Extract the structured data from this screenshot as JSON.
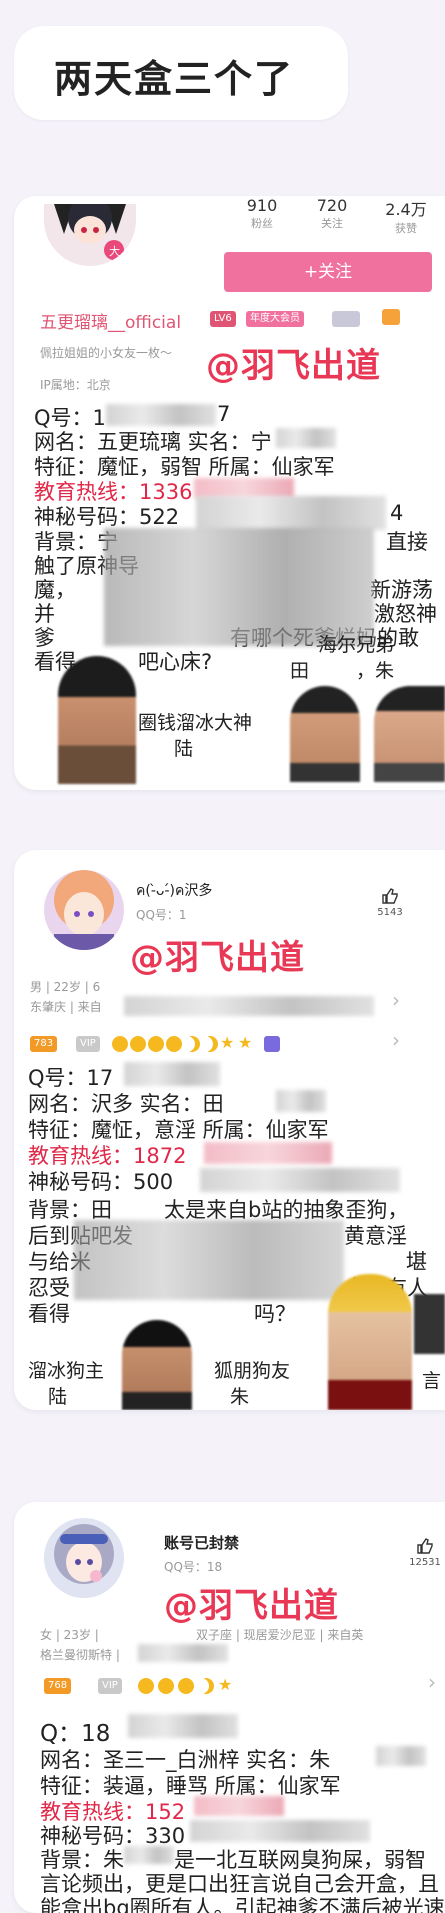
{
  "title": "两天盒三个了",
  "card1": {
    "stats": [
      {
        "num": "910",
        "label": "粉丝"
      },
      {
        "num": "720",
        "label": "关注"
      },
      {
        "num": "2.4万",
        "label": "获赞"
      }
    ],
    "follow_label": "+关注",
    "username": "五更瑠璃__official",
    "level": "LV6",
    "year_badge": "年度大会员",
    "sign": "佩拉姐姐的小女友一枚～",
    "ip": "IP属地：北京",
    "watermark": "@羽飞出道",
    "lines": {
      "qq": "Q号：1",
      "qq_end": "7",
      "netname": "网名：五更琉璃  实名：宁",
      "traits": "特征：魔怔，弱智    所属：仙家军",
      "hotline": "教育热线：1336",
      "secret": "神秘号码：522",
      "secret_end": "4",
      "bg1": "背景：宁",
      "bg1_end": "直接",
      "bg2": "触了原神导",
      "bg3": "魔，",
      "bg3_end": "新游荡",
      "bg4": "并",
      "bg4_end": "激怒神",
      "bg5": "爹",
      "bg5_end": "有哪个死爹烂妈的敢",
      "bg6": "看得",
      "bg6_end": "吧心床?"
    },
    "captions": {
      "c1": "圈钱溜冰大神",
      "c2": "陆",
      "c3": "海尔兄弟",
      "c4": "田",
      "c5": "，朱"
    }
  },
  "card2": {
    "username": "ค(-̀ᴗ-́)ค沢多",
    "qq_label": "QQ号：1",
    "likes": "5143",
    "gender_age": "男 | 22岁 | 6",
    "location": "东肇庆 | 来自",
    "level": "783",
    "vip": "VIP",
    "watermark": "@羽飞出道",
    "lines": {
      "qq": "Q号：17",
      "netname": "网名：沢多    实名：田",
      "traits": "特征：魔怔，意淫      所属：仙家军",
      "hotline": "教育热线：1872",
      "secret": "神秘号码：500",
      "bg1": "背景：田",
      "bg1_mid": "太是来自b站的抽象歪狗，",
      "bg2": "后到贴吧发",
      "bg2_end": "黄意淫",
      "bg3": "与给米",
      "bg3_end": "堪",
      "bg4": "忍受",
      "bg4_end": "全网有人",
      "bg5": "看得",
      "bg5_end": "吗？"
    },
    "captions": {
      "c1": "溜冰狗主",
      "c2": "陆",
      "c3": "狐朋狗友",
      "c4": "朱",
      "c5": "言"
    }
  },
  "card3": {
    "username": "账号已封禁",
    "qq_label": "QQ号：18",
    "likes": "12531",
    "info1": "女 | 23岁 |",
    "info1_end": "双子座 | 现居爱沙尼亚 | 来自英",
    "info2": "格兰曼彻斯特 |",
    "level": "768",
    "vip": "VIP",
    "watermark": "@羽飞出道",
    "lines": {
      "qq": "Q：18",
      "netname": "网名：圣三一_白洲梓  实名：朱",
      "traits": "特征：装逼，睡骂      所属：仙家军",
      "hotline": "教育热线：152",
      "secret": "神秘号码：330",
      "bg1": "背景：朱",
      "bg1_end": "是一北互联网臭狗屎，弱智",
      "bg2": "言论频出，更是口出狂言说自己会开盒，且",
      "bg3": "能盒出bg圈所有人。引起神爹不满后被光速"
    }
  },
  "colors": {
    "accent": "#f0709e",
    "hotline_red": "#e02848",
    "watermark_red": "#e83855"
  }
}
